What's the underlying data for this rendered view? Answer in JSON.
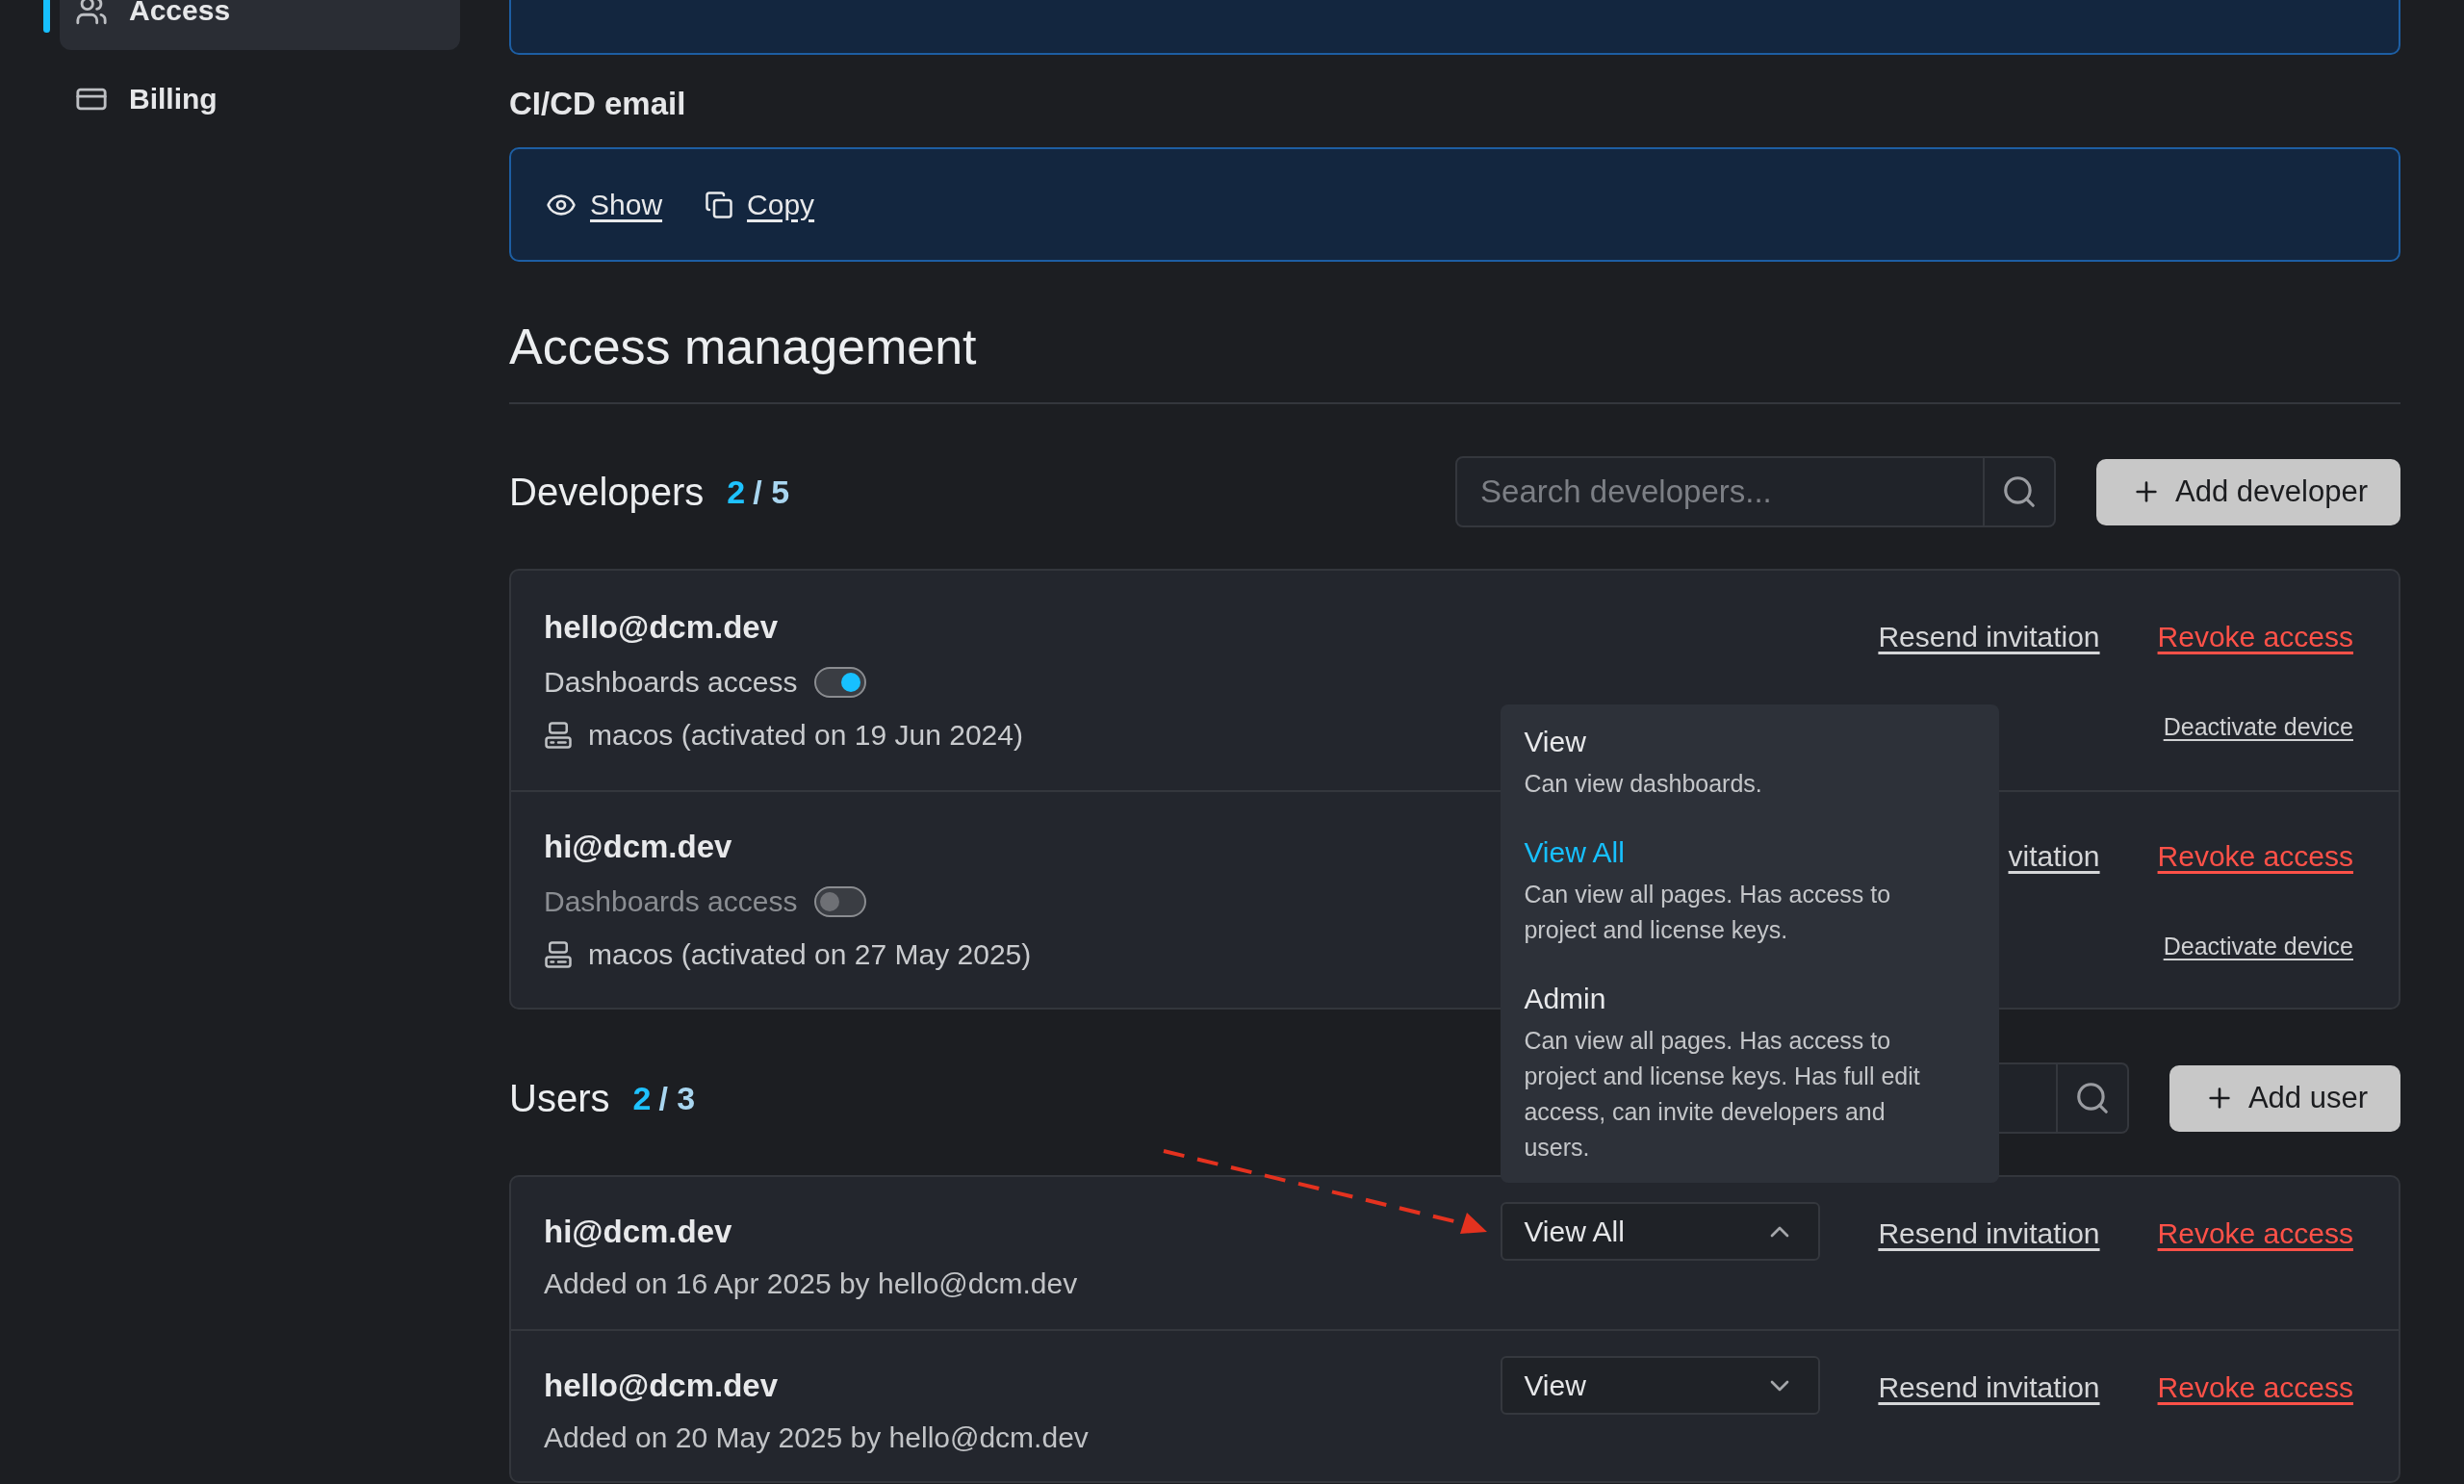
{
  "sidebar": {
    "items": [
      {
        "label": "Access",
        "selected": true
      },
      {
        "label": "Billing",
        "selected": false
      }
    ]
  },
  "secret_cards": [
    {
      "title": "CI/CD email",
      "actions": [
        "Show",
        "Copy"
      ]
    }
  ],
  "access_management": {
    "heading": "Access management",
    "developers": {
      "title": "Developers",
      "count": "2",
      "limit": "/ 5",
      "search": {
        "placeholder": "Search developers..."
      },
      "add_button": "Add developer",
      "rows": [
        {
          "email": "hello@dcm.dev",
          "toggle_label": "Dashboards access",
          "dashboards_access": true,
          "device": "macos (activated on 19 Jun 2024)",
          "resend": "Resend invitation",
          "revoke": "Revoke access",
          "device_action": "Deactivate device"
        },
        {
          "email": "hi@dcm.dev",
          "toggle_label": "Dashboards access",
          "dashboards_access": false,
          "device": "macos (activated on 27 May 2025)",
          "resend": "vitation",
          "revoke": "Revoke access",
          "device_action": "Deactivate device"
        }
      ]
    },
    "users": {
      "title": "Users",
      "count": "2",
      "limit": "/ 3",
      "add_button": "Add user",
      "rows": [
        {
          "email": "hi@dcm.dev",
          "added": "Added on 16 Apr 2025 by hello@dcm.dev",
          "role": "View All",
          "expanded": true,
          "resend": "Resend invitation",
          "revoke": "Revoke access"
        },
        {
          "email": "hello@dcm.dev",
          "added": "Added on 20 May 2025 by hello@dcm.dev",
          "role": "View",
          "expanded": false,
          "resend": "Resend invitation",
          "revoke": "Revoke access"
        }
      ],
      "role_menu": {
        "options": [
          {
            "label": "View",
            "description": "Can view dashboards.",
            "selected": false
          },
          {
            "label": "View All",
            "description": "Can view all pages. Has access to project and license keys.",
            "selected": true
          },
          {
            "label": "Admin",
            "description": "Can view all pages. Has access to project and license keys. Has full edit access, can invite developers and users.",
            "selected": false
          }
        ]
      }
    }
  }
}
